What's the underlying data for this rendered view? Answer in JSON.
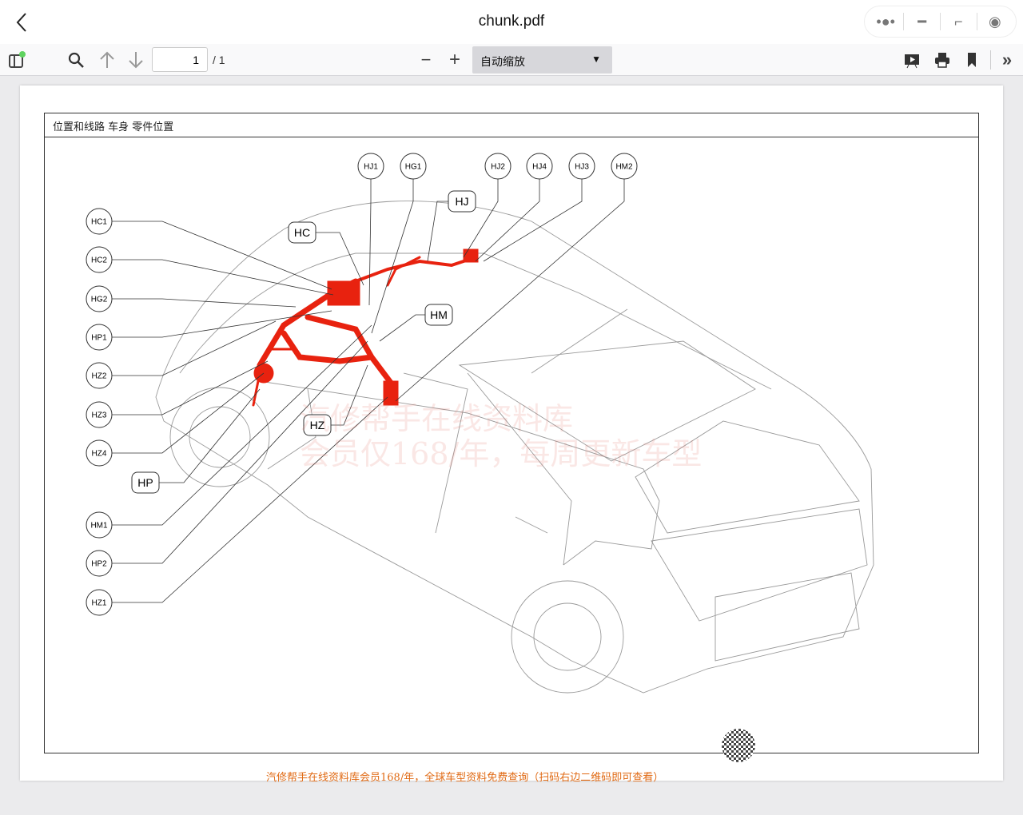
{
  "window": {
    "title": "chunk.pdf",
    "controls": [
      "more-icon",
      "minimize-icon",
      "restore-icon",
      "record-icon"
    ]
  },
  "toolbar": {
    "page_value": "1",
    "page_count": "/ 1",
    "zoom_value": "自动缩放"
  },
  "document": {
    "header": "位置和线路  车身  零件位置",
    "top_labels": [
      "HJ1",
      "HG1",
      "HJ2",
      "HJ4",
      "HJ3",
      "HM2"
    ],
    "left_labels": [
      "HC1",
      "HC2",
      "HG2",
      "HP1",
      "HZ2",
      "HZ3",
      "HZ4",
      "HM1",
      "HP2",
      "HZ1"
    ],
    "group_labels": [
      "HJ",
      "HC",
      "HM",
      "HZ",
      "HP"
    ],
    "watermark": [
      "汽修帮手在线资料库",
      "会员仅168/年，每周更新车型"
    ],
    "footer": "汽修帮手在线资料库会员168/年，全球车型资料免费查询（扫码右边二维码即可查看）",
    "accent": "#e8220f"
  }
}
